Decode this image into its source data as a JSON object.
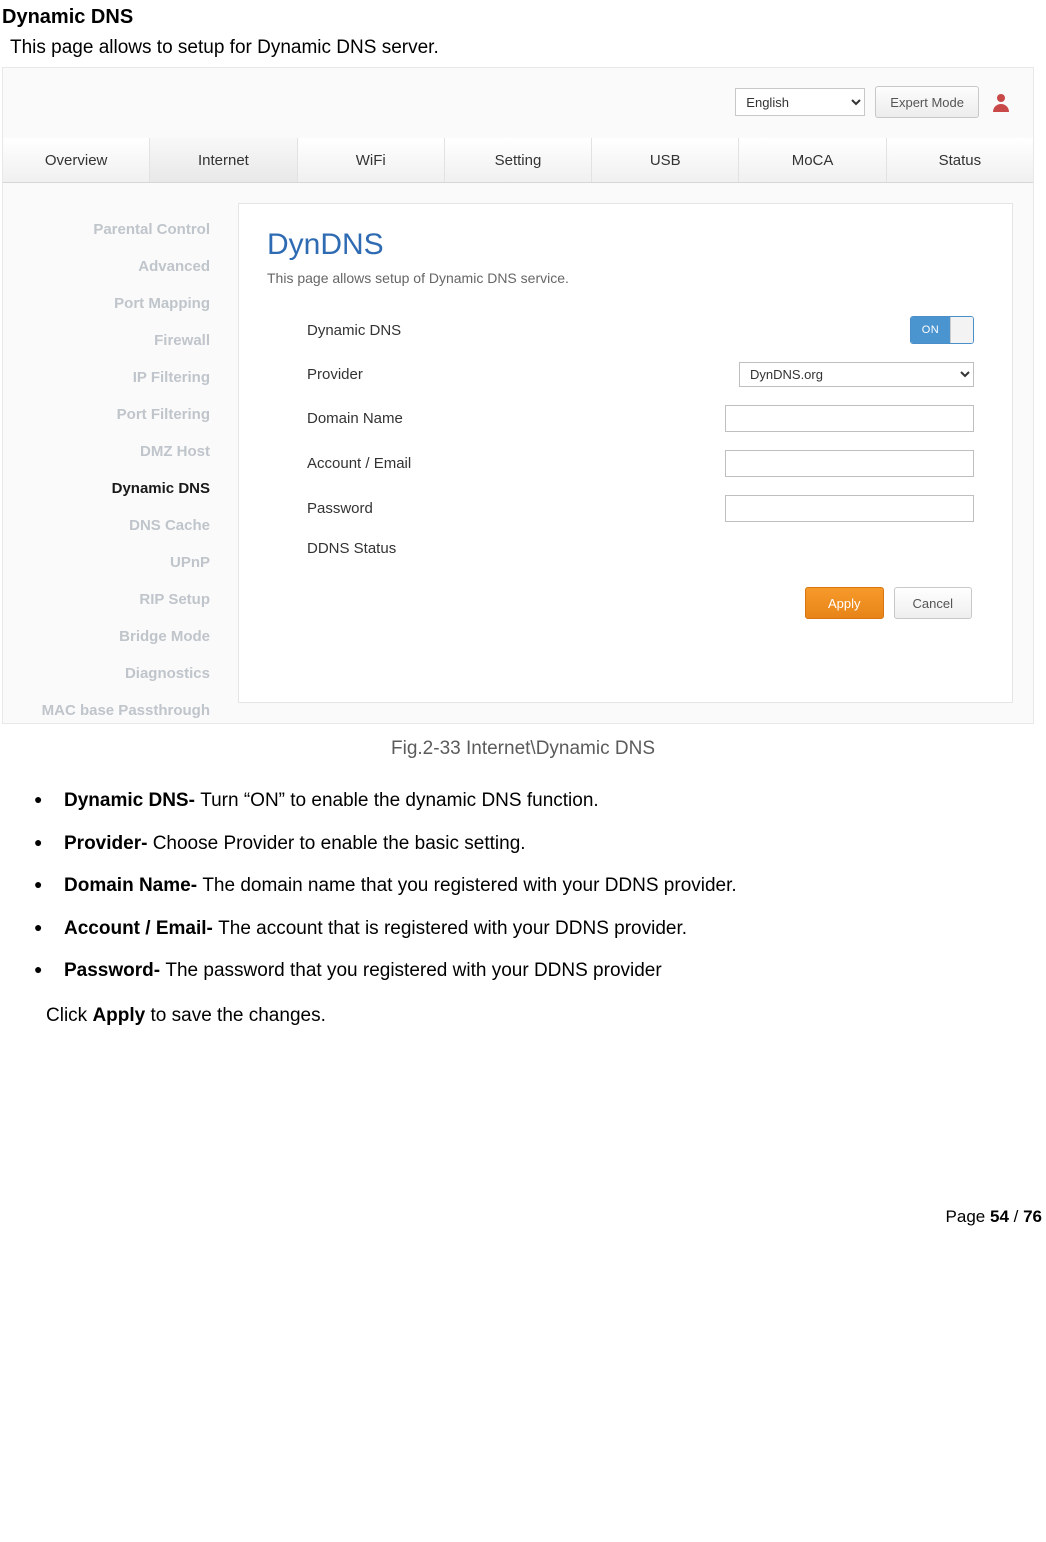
{
  "doc": {
    "heading": "Dynamic DNS",
    "intro": "This page allows to setup for Dynamic DNS server.",
    "caption": "Fig.2-33 Internet\\Dynamic DNS",
    "closing_pre": "Click ",
    "closing_bold": "Apply",
    "closing_post": " to save the changes.",
    "pageno_pre": "Page ",
    "pageno_cur": "54",
    "pageno_sep": " / ",
    "pageno_total": "76"
  },
  "topbar": {
    "language": "English",
    "expert_btn": "Expert Mode"
  },
  "tabs": [
    "Overview",
    "Internet",
    "WiFi",
    "Setting",
    "USB",
    "MoCA",
    "Status"
  ],
  "active_tab_index": 1,
  "sidebar": {
    "items": [
      "Parental Control",
      "Advanced",
      "Port Mapping",
      "Firewall",
      "IP Filtering",
      "Port Filtering",
      "DMZ Host",
      "Dynamic DNS",
      "DNS Cache",
      "UPnP",
      "RIP Setup",
      "Bridge Mode",
      "Diagnostics",
      "MAC base Passthrough"
    ],
    "active_index": 7
  },
  "panel": {
    "title": "DynDNS",
    "subtitle": "This page allows setup of Dynamic DNS service.",
    "rows": {
      "dyndns": "Dynamic DNS",
      "provider": "Provider",
      "domain": "Domain Name",
      "account": "Account / Email",
      "password": "Password",
      "status": "DDNS Status"
    },
    "toggle_label": "ON",
    "provider_value": "DynDNS.org",
    "apply": "Apply",
    "cancel": "Cancel"
  },
  "bullets": [
    {
      "b": "Dynamic DNS- ",
      "t": "Turn “ON” to enable the dynamic DNS function."
    },
    {
      "b": "Provider- ",
      "t": "Choose Provider to enable the basic setting."
    },
    {
      "b": "Domain Name- ",
      "t": "The domain name that you registered with your DDNS provider."
    },
    {
      "b": "Account / Email- ",
      "t": "The account that is registered with your DDNS provider."
    },
    {
      "b": "Password- ",
      "t": "The password that you registered with your DDNS provider"
    }
  ]
}
